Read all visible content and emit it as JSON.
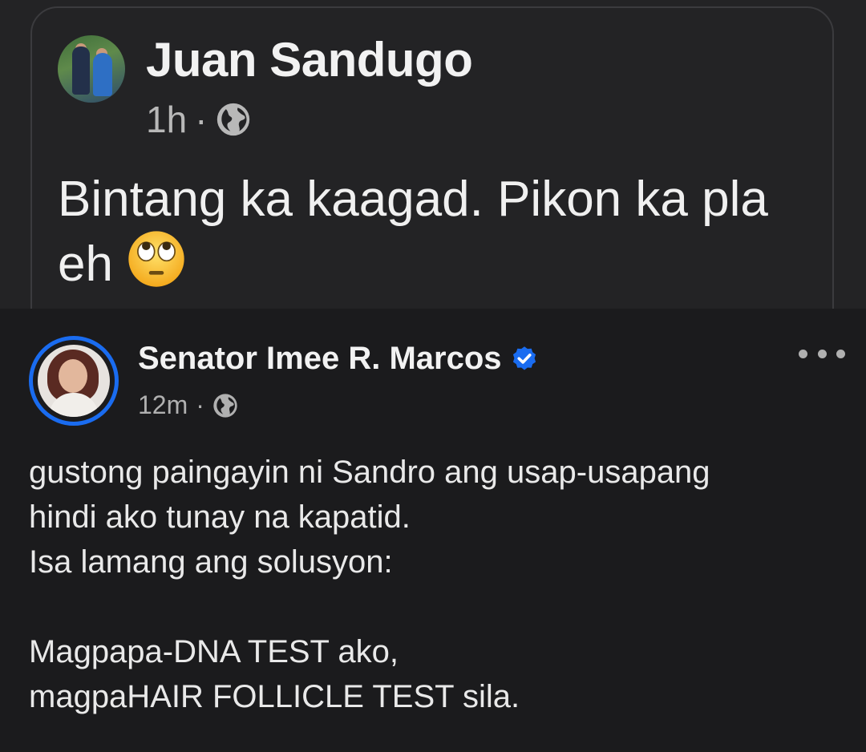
{
  "shared_post": {
    "author": "Juan Sandugo",
    "time": "1h",
    "separator": "·",
    "privacy_icon": "globe-icon",
    "text": "Bintang ka kaagad. Pikon ka pla eh",
    "emoji": "face-with-rolling-eyes"
  },
  "post": {
    "author": "Senator Imee R. Marcos",
    "verified_icon": "verified-badge-icon",
    "time": "12m",
    "separator": "·",
    "privacy_icon": "globe-icon",
    "more_icon": "more-options-icon",
    "lines": [
      "gustong paingayin ni Sandro ang usap-usapang",
      "hindi ako tunay na kapatid.",
      "Isa lamang ang solusyon:",
      "",
      "Magpapa-DNA TEST ako,",
      "magpaHAIR FOLLICLE TEST sila."
    ]
  },
  "colors": {
    "accent": "#1a6cf0",
    "background_top": "#232325",
    "background_bottom": "#1b1b1d"
  }
}
